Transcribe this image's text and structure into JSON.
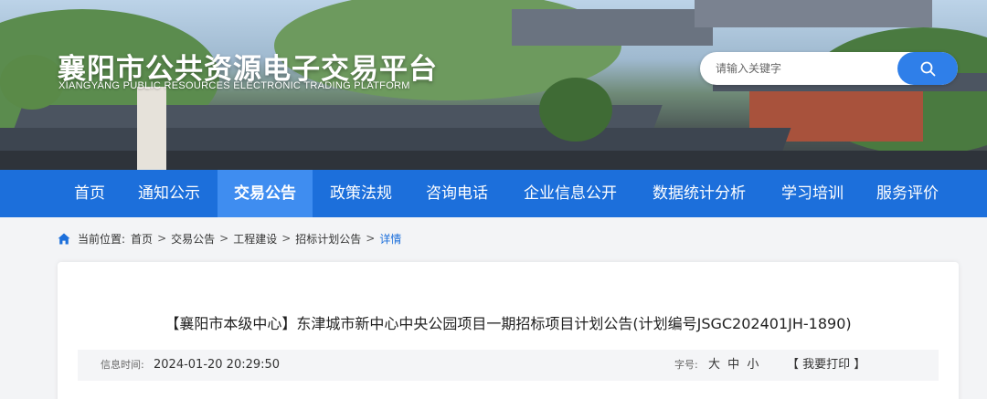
{
  "header": {
    "title": "襄阳市公共资源电子交易平台",
    "subtitle": "XIANGYANG PUBLIC RESOURCES ELECTRONIC TRADING PLATFORM",
    "search": {
      "placeholder": "请输入关键字",
      "icon": "search-icon"
    }
  },
  "nav": {
    "items": [
      {
        "label": "首页"
      },
      {
        "label": "通知公示"
      },
      {
        "label": "交易公告",
        "active": true
      },
      {
        "label": "政策法规"
      },
      {
        "label": "咨询电话"
      },
      {
        "label": "企业信息公开"
      },
      {
        "label": "数据统计分析"
      },
      {
        "label": "学习培训"
      },
      {
        "label": "服务评价"
      }
    ],
    "color": "#1c6fdb",
    "active_color": "#3f8df0"
  },
  "breadcrumb": {
    "prefix": "当前位置:",
    "items": [
      "首页",
      "交易公告",
      "工程建设",
      "招标计划公告"
    ],
    "current": "详情",
    "separator": ">"
  },
  "article": {
    "title": "【襄阳市本级中心】东津城市新中心中央公园项目一期招标项目计划公告(计划编号JSGC202401JH-1890)",
    "meta": {
      "time_label": "信息时间:",
      "time_value": "2024-01-20 20:29:50",
      "font_label": "字号:",
      "font_sizes": [
        "大",
        "中",
        "小"
      ],
      "print_label": "【 我要打印 】"
    }
  }
}
